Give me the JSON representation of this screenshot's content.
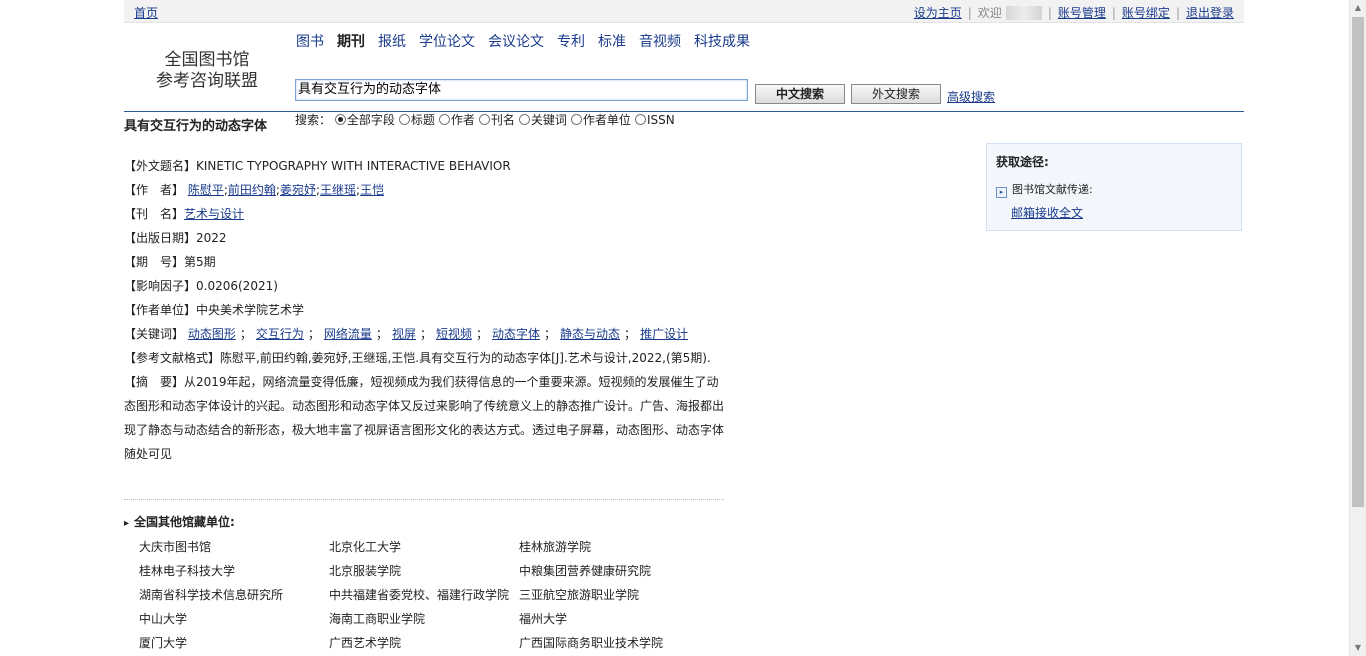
{
  "topbar": {
    "home": "首页",
    "set_home": "设为主页",
    "welcome": "欢迎",
    "account_manage": "账号管理",
    "account_bind": "账号绑定",
    "logout": "退出登录"
  },
  "logo": {
    "line1": "全国图书馆",
    "line2": "参考咨询联盟"
  },
  "tabs": [
    {
      "label": "图书",
      "active": false
    },
    {
      "label": "期刊",
      "active": true
    },
    {
      "label": "报纸",
      "active": false
    },
    {
      "label": "学位论文",
      "active": false
    },
    {
      "label": "会议论文",
      "active": false
    },
    {
      "label": "专利",
      "active": false
    },
    {
      "label": "标准",
      "active": false
    },
    {
      "label": "音视频",
      "active": false
    },
    {
      "label": "科技成果",
      "active": false
    }
  ],
  "search": {
    "value": "具有交互行为的动态字体",
    "cn_button": "中文搜索",
    "foreign_button": "外文搜索",
    "advanced": "高级搜索",
    "scope_label": "搜索：",
    "scopes": [
      {
        "label": "全部字段",
        "checked": true
      },
      {
        "label": "标题",
        "checked": false
      },
      {
        "label": "作者",
        "checked": false
      },
      {
        "label": "刊名",
        "checked": false
      },
      {
        "label": "关键词",
        "checked": false
      },
      {
        "label": "作者单位",
        "checked": false
      },
      {
        "label": "ISSN",
        "checked": false
      }
    ]
  },
  "article": {
    "title": "具有交互行为的动态字体",
    "foreign_title_label": "【外文题名】",
    "foreign_title": "KINETIC TYPOGRAPHY WITH INTERACTIVE BEHAVIOR",
    "authors_label": "【作　者】",
    "authors": [
      "陈慰平",
      "前田约翰",
      "姜宛妤",
      "王继瑶",
      "王恺"
    ],
    "journal_label": "【刊　名】",
    "journal": "艺术与设计",
    "pubdate_label": "【出版日期】",
    "pubdate": "2022",
    "issue_label": "【期　号】",
    "issue": "第5期",
    "impact_label": "【影响因子】",
    "impact": "0.0206(2021)",
    "affiliation_label": "【作者单位】",
    "affiliation": "中央美术学院艺术学",
    "keywords_label": "【关键词】",
    "keywords": [
      "动态图形",
      "交互行为",
      "网络流量",
      "视屏",
      "短视频",
      "动态字体",
      "静态与动态",
      "推广设计"
    ],
    "citation_label": "【参考文献格式】",
    "citation": "陈慰平,前田约翰,姜宛妤,王继瑶,王恺.具有交互行为的动态字体[J].艺术与设计,2022,(第5期).",
    "abstract_label": "【摘　要】",
    "abstract": "从2019年起，网络流量变得低廉，短视频成为我们获得信息的一个重要来源。短视频的发展催生了动态图形和动态字体设计的兴起。动态图形和动态字体又反过来影响了传统意义上的静态推广设计。广告、海报都出现了静态与动态结合的新形态，极大地丰富了视屏语言图形文化的表达方式。透过电子屏幕，动态图形、动态字体随处可见"
  },
  "holdings": {
    "title": "全国其他馆藏单位:",
    "items": [
      "大庆市图书馆",
      "北京化工大学",
      "桂林旅游学院",
      "桂林电子科技大学",
      "北京服装学院",
      "中粮集团营养健康研究院",
      "湖南省科学技术信息研究所",
      "中共福建省委党校、福建行政学院",
      "三亚航空旅游职业学院",
      "中山大学",
      "海南工商职业学院",
      "福州大学",
      "厦门大学",
      "广西艺术学院",
      "广西国际商务职业技术学院"
    ]
  },
  "side": {
    "heading": "获取途径:",
    "source": "图书馆文献传递:",
    "mail_link": "邮箱接收全文"
  }
}
